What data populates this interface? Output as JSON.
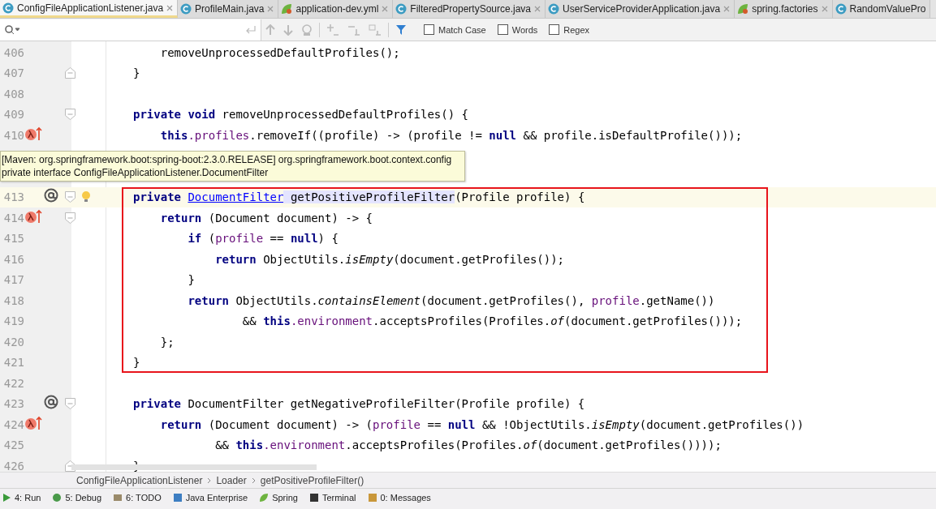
{
  "tabs": [
    {
      "label": "ConfigFileApplicationListener.java",
      "kind": "java",
      "selected": true,
      "closable": true
    },
    {
      "label": "ProfileMain.java",
      "kind": "java",
      "selected": false,
      "closable": true
    },
    {
      "label": "application-dev.yml",
      "kind": "spring",
      "selected": false,
      "closable": true
    },
    {
      "label": "FilteredPropertySource.java",
      "kind": "java",
      "selected": false,
      "closable": true
    },
    {
      "label": "UserServiceProviderApplication.java",
      "kind": "java",
      "selected": false,
      "closable": true
    },
    {
      "label": "spring.factories",
      "kind": "spring",
      "selected": false,
      "closable": true
    },
    {
      "label": "RandomValuePro",
      "kind": "java",
      "selected": false,
      "closable": false
    }
  ],
  "search": {
    "options": [
      {
        "label": "Match Case",
        "checked": false
      },
      {
        "label": "Words",
        "checked": false
      },
      {
        "label": "Regex",
        "checked": false
      }
    ]
  },
  "code_lines": [
    {
      "number": "406",
      "tokens": [
        {
          "kind": "plain",
          "t": "    removeUnprocessedDefaultProfiles();"
        }
      ]
    },
    {
      "number": "407",
      "fold_end": true,
      "tokens": [
        {
          "kind": "plain",
          "t": "}"
        }
      ]
    },
    {
      "number": "408"
    },
    {
      "number": "409",
      "fold_start": true,
      "tokens": [
        {
          "kind": "keyword",
          "t": "private void "
        },
        {
          "kind": "plain",
          "t": "removeUnprocessedDefaultProfiles() {"
        }
      ]
    },
    {
      "number": "410",
      "lambda_marker": true,
      "tokens": [
        {
          "kind": "keyword",
          "t": "    this"
        },
        {
          "kind": "field",
          "t": ".profiles"
        },
        {
          "kind": "plain",
          "t": ".removeIf((profile) -> (profile != "
        },
        {
          "kind": "keyword",
          "t": "null"
        },
        {
          "kind": "plain",
          "t": " && profile.isDefaultProfile()));"
        }
      ]
    },
    {
      "tooltip": [
        "[Maven: org.springframework.boot:spring-boot:2.3.0.RELEASE] org.springframework.boot.context.config",
        "private interface ConfigFileApplicationListener.DocumentFilter"
      ]
    },
    {
      "number": "413",
      "annotation_marker": true,
      "bulb": true,
      "current": true,
      "fold_start": true,
      "boxed": true,
      "tokens": [
        {
          "kind": "keyword",
          "t": "private "
        },
        {
          "kind": "link",
          "t": "DocumentFilter"
        },
        {
          "kind": "highlight",
          "t": " getPositiveProfileFilter"
        },
        {
          "kind": "plain",
          "t": "(Profile profile) {"
        }
      ]
    },
    {
      "number": "414",
      "lambda_marker": true,
      "fold_start": true,
      "boxed": true,
      "tokens": [
        {
          "kind": "keyword",
          "t": "    return "
        },
        {
          "kind": "plain",
          "t": "(Document document) -> {"
        }
      ]
    },
    {
      "number": "415",
      "boxed": true,
      "tokens": [
        {
          "kind": "keyword",
          "t": "        if "
        },
        {
          "kind": "plain",
          "t": "("
        },
        {
          "kind": "field",
          "t": "profile"
        },
        {
          "kind": "plain",
          "t": " == "
        },
        {
          "kind": "keyword",
          "t": "null"
        },
        {
          "kind": "plain",
          "t": ") {"
        }
      ]
    },
    {
      "number": "416",
      "boxed": true,
      "tokens": [
        {
          "kind": "keyword",
          "t": "            return "
        },
        {
          "kind": "plain",
          "t": "ObjectUtils."
        },
        {
          "kind": "static",
          "t": "isEmpty"
        },
        {
          "kind": "plain",
          "t": "(document.getProfiles());"
        }
      ]
    },
    {
      "number": "417",
      "boxed": true,
      "tokens": [
        {
          "kind": "plain",
          "t": "        }"
        }
      ]
    },
    {
      "number": "418",
      "boxed": true,
      "tokens": [
        {
          "kind": "keyword",
          "t": "        return "
        },
        {
          "kind": "plain",
          "t": "ObjectUtils."
        },
        {
          "kind": "static",
          "t": "containsElement"
        },
        {
          "kind": "plain",
          "t": "(document.getProfiles(), "
        },
        {
          "kind": "field",
          "t": "profile"
        },
        {
          "kind": "plain",
          "t": ".getName())"
        }
      ]
    },
    {
      "number": "419",
      "boxed": true,
      "tokens": [
        {
          "kind": "plain",
          "t": "                && "
        },
        {
          "kind": "keyword",
          "t": "this"
        },
        {
          "kind": "field",
          "t": ".environment"
        },
        {
          "kind": "plain",
          "t": ".acceptsProfiles(Profiles."
        },
        {
          "kind": "static",
          "t": "of"
        },
        {
          "kind": "plain",
          "t": "(document.getProfiles()));"
        }
      ]
    },
    {
      "number": "420",
      "boxed": true,
      "tokens": [
        {
          "kind": "plain",
          "t": "    };"
        }
      ]
    },
    {
      "number": "421",
      "boxed": true,
      "tokens": [
        {
          "kind": "plain",
          "t": "}"
        }
      ]
    },
    {
      "number": "422"
    },
    {
      "number": "423",
      "annotation_marker": true,
      "fold_start": true,
      "tokens": [
        {
          "kind": "keyword",
          "t": "private "
        },
        {
          "kind": "plain",
          "t": "DocumentFilter getNegativeProfileFilter(Profile profile) {"
        }
      ]
    },
    {
      "number": "424",
      "lambda_marker": true,
      "tokens": [
        {
          "kind": "keyword",
          "t": "    return "
        },
        {
          "kind": "plain",
          "t": "(Document document) -> ("
        },
        {
          "kind": "field",
          "t": "profile"
        },
        {
          "kind": "plain",
          "t": " == "
        },
        {
          "kind": "keyword",
          "t": "null"
        },
        {
          "kind": "plain",
          "t": " && !ObjectUtils."
        },
        {
          "kind": "static",
          "t": "isEmpty"
        },
        {
          "kind": "plain",
          "t": "(document.getProfiles())"
        }
      ]
    },
    {
      "number": "425",
      "tokens": [
        {
          "kind": "plain",
          "t": "            && "
        },
        {
          "kind": "keyword",
          "t": "this"
        },
        {
          "kind": "field",
          "t": ".environment"
        },
        {
          "kind": "plain",
          "t": ".acceptsProfiles(Profiles."
        },
        {
          "kind": "static",
          "t": "of"
        },
        {
          "kind": "plain",
          "t": "(document.getProfiles())));"
        }
      ]
    },
    {
      "number": "426",
      "fold_end": true,
      "tokens": [
        {
          "kind": "plain",
          "t": "}"
        }
      ]
    }
  ],
  "breadcrumb": [
    "ConfigFileApplicationListener",
    "Loader",
    "getPositiveProfileFilter()"
  ],
  "tool_windows": [
    {
      "label": "4: Run",
      "kind": "run"
    },
    {
      "label": "5: Debug",
      "kind": "debug"
    },
    {
      "label": "6: TODO",
      "kind": "todo"
    },
    {
      "label": "Java Enterprise",
      "kind": "enterprise"
    },
    {
      "label": "Spring",
      "kind": "spring"
    },
    {
      "label": "Terminal",
      "kind": "terminal"
    },
    {
      "label": "0: Messages",
      "kind": "messages"
    }
  ]
}
